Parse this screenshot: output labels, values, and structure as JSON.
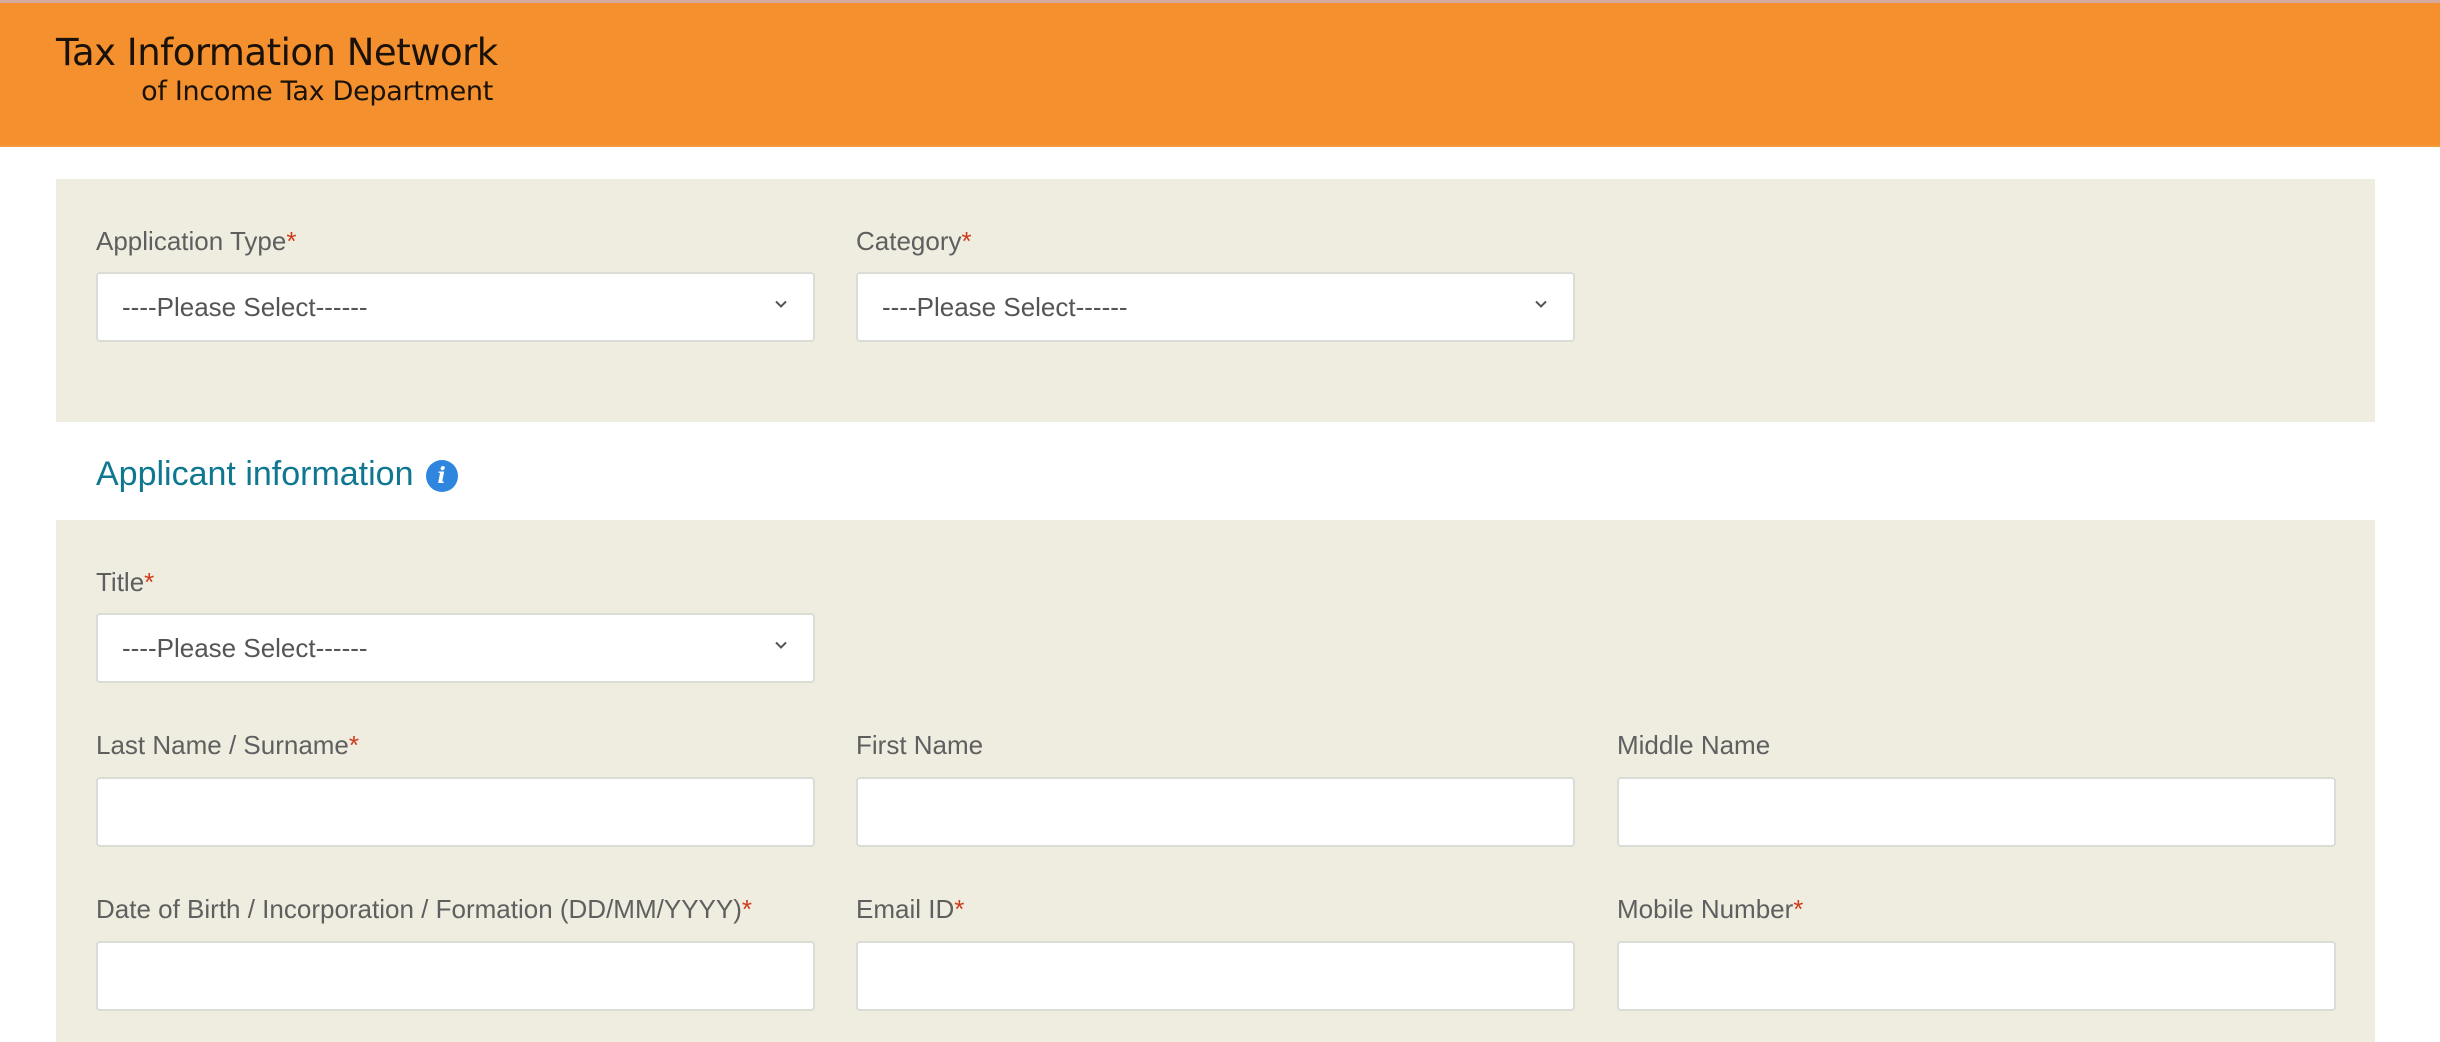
{
  "header": {
    "brand_line1": "Tax Information Network",
    "brand_line2": "of Income Tax Department",
    "background_color": "#f5902f"
  },
  "application_section": {
    "application_type": {
      "label": "Application Type",
      "required_marker": "*",
      "selected": "----Please Select------",
      "icon": "chevron-down-icon"
    },
    "category": {
      "label": "Category",
      "required_marker": "*",
      "selected": "----Please Select------",
      "icon": "chevron-down-icon"
    }
  },
  "applicant_section": {
    "heading": "Applicant information",
    "heading_icon": "info-icon",
    "heading_color": "#0f7790",
    "title": {
      "label": "Title",
      "required_marker": "*",
      "selected": "----Please Select------",
      "icon": "chevron-down-icon"
    },
    "last_name": {
      "label": "Last Name / Surname",
      "required_marker": "*",
      "value": "",
      "placeholder": ""
    },
    "first_name": {
      "label": "First Name",
      "required_marker": "",
      "value": "",
      "placeholder": ""
    },
    "middle_name": {
      "label": "Middle Name",
      "required_marker": "",
      "value": "",
      "placeholder": ""
    },
    "dob": {
      "label": "Date of Birth / Incorporation / Formation (DD/MM/YYYY)",
      "required_marker": "*",
      "value": "",
      "placeholder": ""
    },
    "email": {
      "label": "Email ID",
      "required_marker": "*",
      "value": "",
      "placeholder": ""
    },
    "mobile": {
      "label": "Mobile Number",
      "required_marker": "*",
      "value": "",
      "placeholder": ""
    }
  },
  "colors": {
    "panel_background": "#efede0",
    "required_marker": "#d03b1a",
    "info_icon": "#2f86de"
  }
}
